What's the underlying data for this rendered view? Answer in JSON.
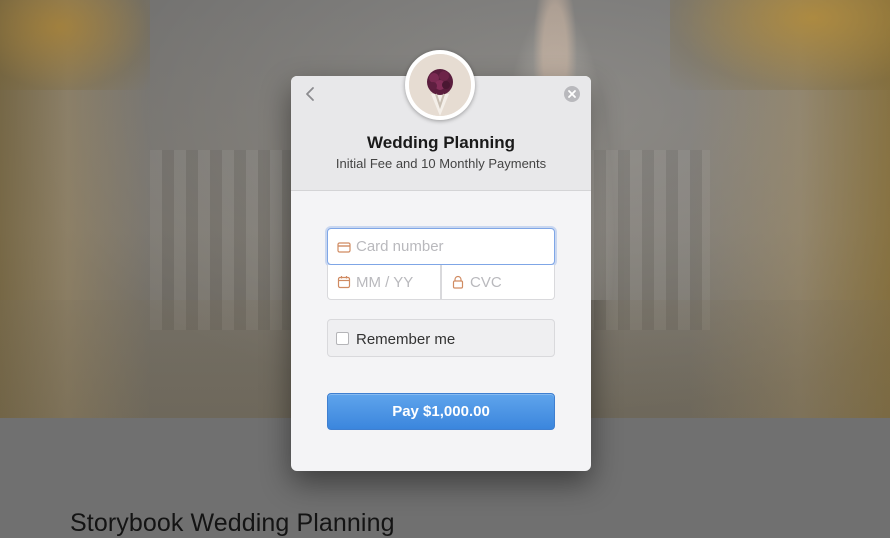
{
  "background": {
    "page_title": "Storybook Wedding Planning"
  },
  "modal": {
    "title": "Wedding Planning",
    "subtitle": "Initial Fee and 10 Monthly Payments",
    "avatar_icon": "bouquet-image",
    "back_icon": "chevron-left-icon",
    "close_icon": "close-icon"
  },
  "form": {
    "card_number": {
      "value": "",
      "placeholder": "Card number",
      "icon": "credit-card-icon"
    },
    "expiry": {
      "value": "",
      "placeholder": "MM / YY",
      "icon": "calendar-icon"
    },
    "cvc": {
      "value": "",
      "placeholder": "CVC",
      "icon": "lock-icon"
    },
    "remember_me": {
      "label": "Remember me",
      "checked": false
    },
    "pay_button": {
      "label": "Pay $1,000.00"
    }
  },
  "colors": {
    "accent": "#3b86dd",
    "focus_border": "#7fa6e6"
  }
}
